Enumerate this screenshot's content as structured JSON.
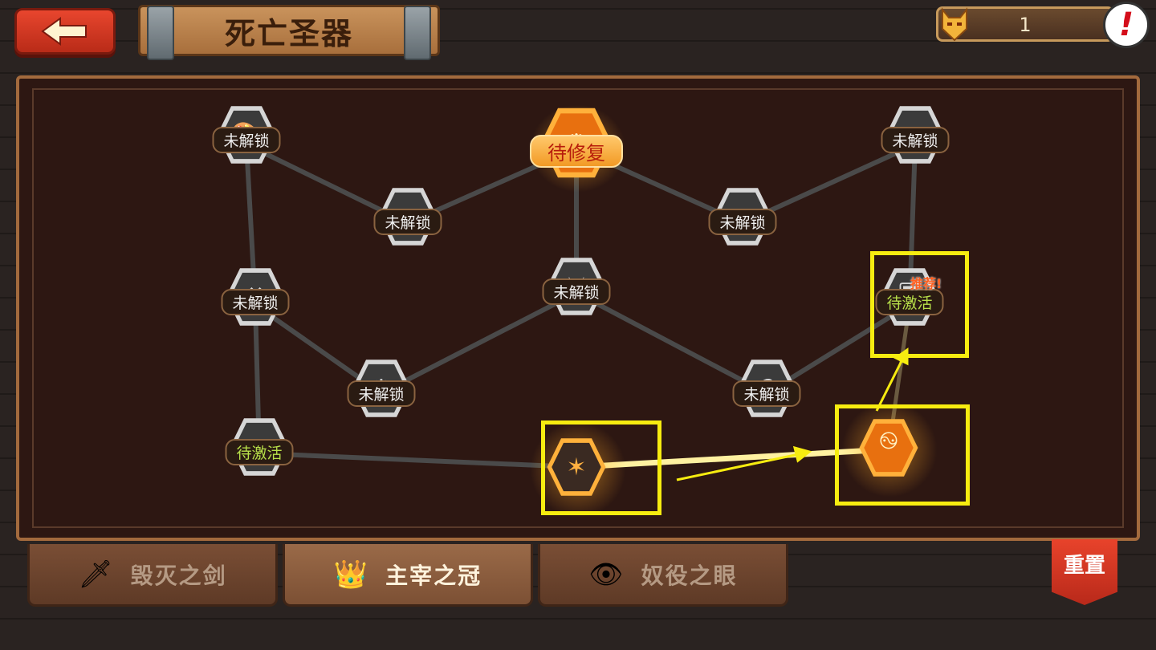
{
  "header": {
    "back_icon": "left-arrow-icon",
    "title": "死亡圣器",
    "currency_value": "1",
    "currency_icon": "devil-head-icon",
    "alert_icon": "exclamation-icon",
    "alert_glyph": "!"
  },
  "board": {
    "nodes": [
      {
        "id": "n1",
        "icon": "palette-icon",
        "glyph": "🎨",
        "label": "未解锁",
        "state": "locked"
      },
      {
        "id": "n2",
        "icon": "crown-book-icon",
        "glyph": "♛",
        "label": "待修复",
        "state": "repair"
      },
      {
        "id": "n3",
        "icon": "castle-icon",
        "glyph": "▥",
        "label": "未解锁",
        "state": "locked"
      },
      {
        "id": "n4",
        "icon": "scroll-quill-icon",
        "glyph": "✒",
        "label": "未解锁",
        "state": "locked"
      },
      {
        "id": "n5",
        "icon": "gem-icon",
        "glyph": "◈",
        "label": "未解锁",
        "state": "locked"
      },
      {
        "id": "n6",
        "icon": "anvil-icon",
        "glyph": "⚒",
        "label": "未解锁",
        "state": "locked"
      },
      {
        "id": "n7",
        "icon": "sword-shield-icon",
        "glyph": "⚔",
        "label": "未解锁",
        "state": "locked"
      },
      {
        "id": "n8",
        "icon": "card-icon",
        "glyph": "🂠",
        "label": "待激活",
        "state": "pending",
        "badge": "推荐!"
      },
      {
        "id": "n9",
        "icon": "gears-icon",
        "glyph": "⚙",
        "label": "未解锁",
        "state": "locked"
      },
      {
        "id": "n10",
        "icon": "potion-icon",
        "glyph": "⚗",
        "label": "未解锁",
        "state": "locked"
      },
      {
        "id": "n11",
        "icon": "serpent-icon",
        "glyph": "ஐ",
        "label": "待激活",
        "state": "pending"
      },
      {
        "id": "n12",
        "icon": "pentagram-icon",
        "glyph": "✶",
        "label": "",
        "state": "active"
      },
      {
        "id": "n13",
        "icon": "swirl-icon",
        "glyph": "࿊",
        "label": "",
        "state": "active"
      }
    ]
  },
  "tabs": [
    {
      "label": "毁灭之剑",
      "icon": "sword-icon",
      "glyph": "🗡",
      "active": false
    },
    {
      "label": "主宰之冠",
      "icon": "crown-icon",
      "glyph": "👑",
      "active": true
    },
    {
      "label": "奴役之眼",
      "icon": "eye-icon",
      "glyph": "👁",
      "active": false
    }
  ],
  "reset_label": "重置",
  "colors": {
    "highlight": "#f7ec10",
    "active_node": "#e8700f",
    "pending_label": "#b8e04a"
  }
}
